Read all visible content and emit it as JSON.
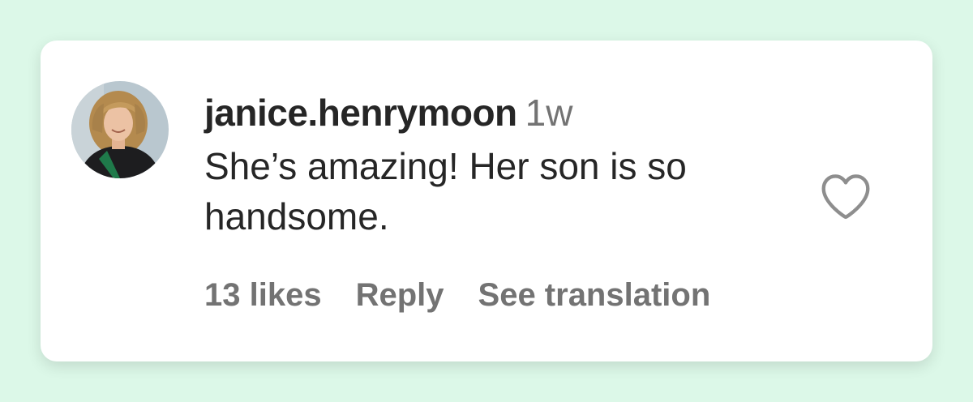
{
  "comment": {
    "username": "janice.henrymoon",
    "timestamp": "1w",
    "text": "She’s amazing! Her son is so handsome.",
    "actions": {
      "likes": "13 likes",
      "reply": "Reply",
      "translate": "See translation"
    },
    "like_icon": "heart-outline-icon"
  },
  "colors": {
    "page_background": "#dcf8e8",
    "card_background": "#ffffff",
    "primary_text": "#262626",
    "secondary_text": "#737373"
  }
}
